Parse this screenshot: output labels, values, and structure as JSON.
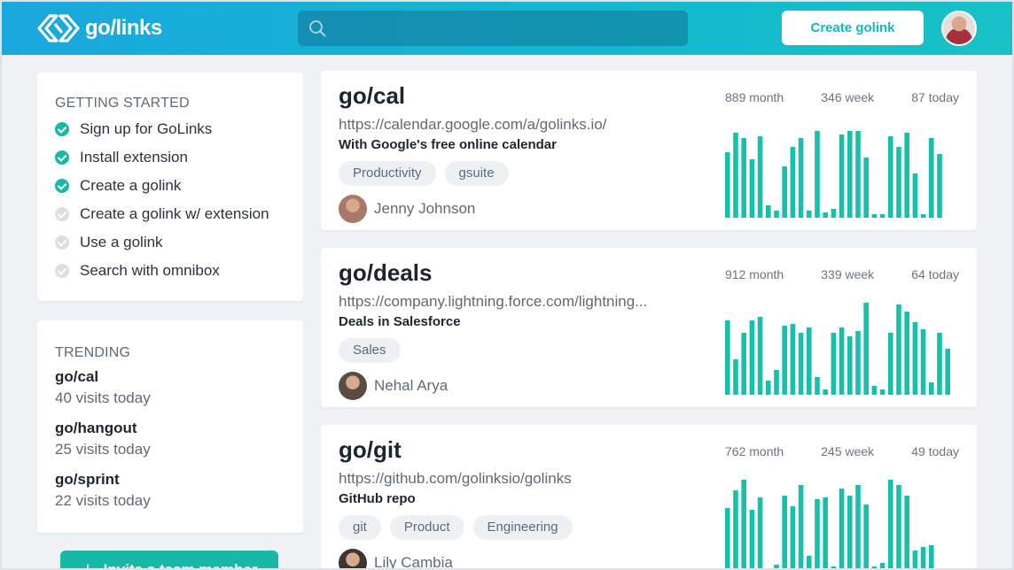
{
  "header": {
    "logo_text": "go/links",
    "search_placeholder": "",
    "create_label": "Create golink"
  },
  "getting_started": {
    "title": "GETTING STARTED",
    "items": [
      {
        "label": "Sign up for GoLinks",
        "done": true
      },
      {
        "label": "Install extension",
        "done": true
      },
      {
        "label": "Create a golink",
        "done": true
      },
      {
        "label": "Create a golink w/ extension",
        "done": false
      },
      {
        "label": "Use a golink",
        "done": false
      },
      {
        "label": "Search with omnibox",
        "done": false
      }
    ]
  },
  "trending": {
    "title": "TRENDING",
    "items": [
      {
        "name": "go/cal",
        "count": "40 visits today"
      },
      {
        "name": "go/hangout",
        "count": "25 visits today"
      },
      {
        "name": "go/sprint",
        "count": "22 visits today"
      }
    ]
  },
  "invite": {
    "label": "Invite a team member"
  },
  "links": [
    {
      "name": "go/cal",
      "url": "https://calendar.google.com/a/golinks.io/",
      "description": "With Google's free online calendar",
      "tags": [
        "Productivity",
        "gsuite"
      ],
      "owner": "Jenny Johnson",
      "owner_color": "#a8786a",
      "stats": {
        "month": "889 month",
        "week": "346 week",
        "today": "87 today"
      },
      "bars": [
        74,
        96,
        90,
        66,
        92,
        14,
        8,
        58,
        80,
        90,
        8,
        98,
        6,
        10,
        94,
        98,
        98,
        68,
        4,
        4,
        92,
        80,
        96,
        50,
        4,
        90,
        72
      ]
    },
    {
      "name": "go/deals",
      "url": "https://company.lightning.force.com/lightning...",
      "description": "Deals in Salesforce",
      "tags": [
        "Sales"
      ],
      "owner": "Nehal Arya",
      "owner_color": "#5a4b44",
      "stats": {
        "month": "912 month",
        "week": "339 week",
        "today": "64 today"
      },
      "bars": [
        84,
        40,
        70,
        84,
        88,
        16,
        28,
        78,
        80,
        70,
        76,
        20,
        6,
        70,
        76,
        66,
        72,
        104,
        10,
        6,
        70,
        102,
        94,
        82,
        74,
        14,
        70,
        52
      ]
    },
    {
      "name": "go/git",
      "url": "https://github.com/golinksio/golinks",
      "description": "GitHub repo",
      "tags": [
        "git",
        "Product",
        "Engineering"
      ],
      "owner": "Lily Cambia",
      "owner_color": "#3f3430",
      "stats": {
        "month": "762 month",
        "week": "245 week",
        "today": "49 today"
      },
      "bars": [
        72,
        92,
        106,
        70,
        84,
        4,
        8,
        86,
        74,
        98,
        18,
        82,
        84,
        6,
        94,
        86,
        98,
        76,
        6,
        10,
        108,
        98,
        86,
        24,
        28,
        30
      ]
    }
  ],
  "colors": {
    "accent": "#17b8a6",
    "header": "#1aa8dd",
    "bar": "#17c0aa"
  }
}
